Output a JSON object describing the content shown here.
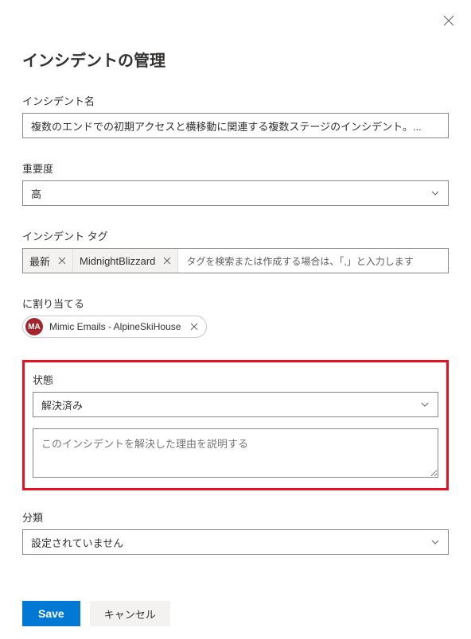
{
  "title": "インシデントの管理",
  "close": "×",
  "fields": {
    "incidentName": {
      "label": "インシデント名",
      "value": "複数のエンドでの初期アクセスと横移動に関連する複数ステージのインシデント。..."
    },
    "severity": {
      "label": "重要度",
      "value": "高"
    },
    "tags": {
      "label": "インシデント タグ",
      "items": [
        "最新",
        "MidnightBlizzard"
      ],
      "placeholder": "タグを検索または作成する場合は、「,」と入力します"
    },
    "assignTo": {
      "label": "に割り当てる",
      "avatarInitials": "MA",
      "name": "Mimic Emails - AlpineSkiHouse"
    },
    "status": {
      "label": "状態",
      "value": "解決済み"
    },
    "reason": {
      "placeholder": "このインシデントを解決した理由を説明する"
    },
    "classification": {
      "label": "分類",
      "value": "設定されていません"
    }
  },
  "buttons": {
    "save": "Save",
    "cancel": "キャンセル"
  }
}
